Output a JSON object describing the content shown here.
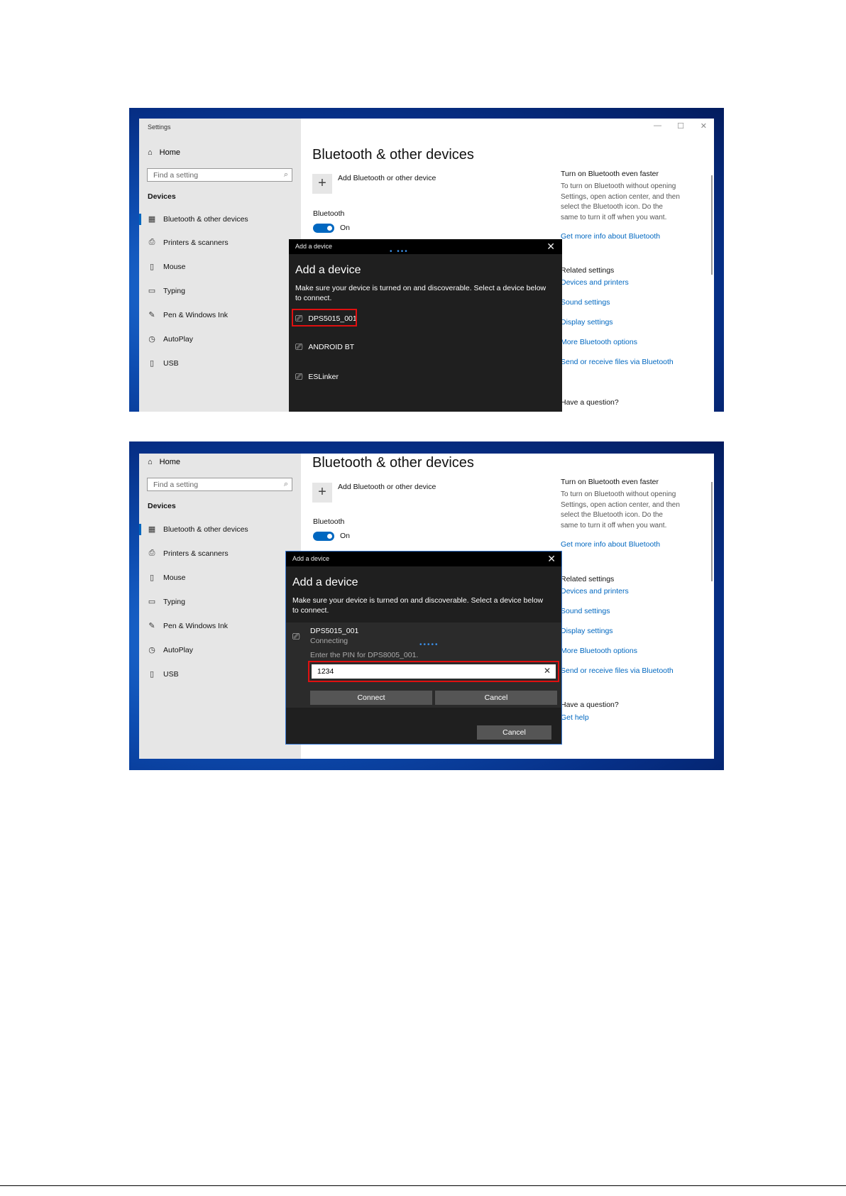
{
  "settings": {
    "app_title": "Settings",
    "home": "Home",
    "search_placeholder": "Find a setting",
    "section": "Devices",
    "nav": [
      {
        "label": "Bluetooth & other devices",
        "icon": "bluetooth-devices-icon"
      },
      {
        "label": "Printers & scanners",
        "icon": "printer-icon"
      },
      {
        "label": "Mouse",
        "icon": "mouse-icon"
      },
      {
        "label": "Typing",
        "icon": "keyboard-icon"
      },
      {
        "label": "Pen & Windows Ink",
        "icon": "pen-icon"
      },
      {
        "label": "AutoPlay",
        "icon": "autoplay-icon"
      },
      {
        "label": "USB",
        "icon": "usb-icon"
      }
    ],
    "page_title": "Bluetooth & other devices",
    "add_label": "Add Bluetooth or other device",
    "bluetooth_label": "Bluetooth",
    "toggle_state": "On",
    "right_panel": {
      "faster_heading": "Turn on Bluetooth even faster",
      "faster_text": "To turn on Bluetooth without opening Settings, open action center, and then select the Bluetooth icon. Do the same to turn it off when you want.",
      "more_info_link": "Get more info about Bluetooth",
      "related_heading": "Related settings",
      "related_links": [
        "Devices and printers",
        "Sound settings",
        "Display settings",
        "More Bluetooth options",
        "Send or receive files via Bluetooth"
      ],
      "question_heading": "Have a question?",
      "help_link": "Get help"
    }
  },
  "dialog": {
    "title": "Add a device",
    "heading": "Add a device",
    "instructions": "Make sure your device is turned on and discoverable. Select a device below to connect.",
    "devices": [
      "DPS5015_001",
      "ANDROID BT",
      "ESLinker"
    ],
    "connecting_device": "DPS5015_001",
    "connecting_status": "Connecting",
    "pin_prompt": "Enter the PIN for DPS8005_001.",
    "pin_value": "1234",
    "connect_button": "Connect",
    "cancel_button": "Cancel",
    "dialog_cancel_button": "Cancel"
  },
  "colors": {
    "accent": "#0067c0",
    "highlight": "#e01010",
    "dialog_bg": "#1f1f1f"
  }
}
